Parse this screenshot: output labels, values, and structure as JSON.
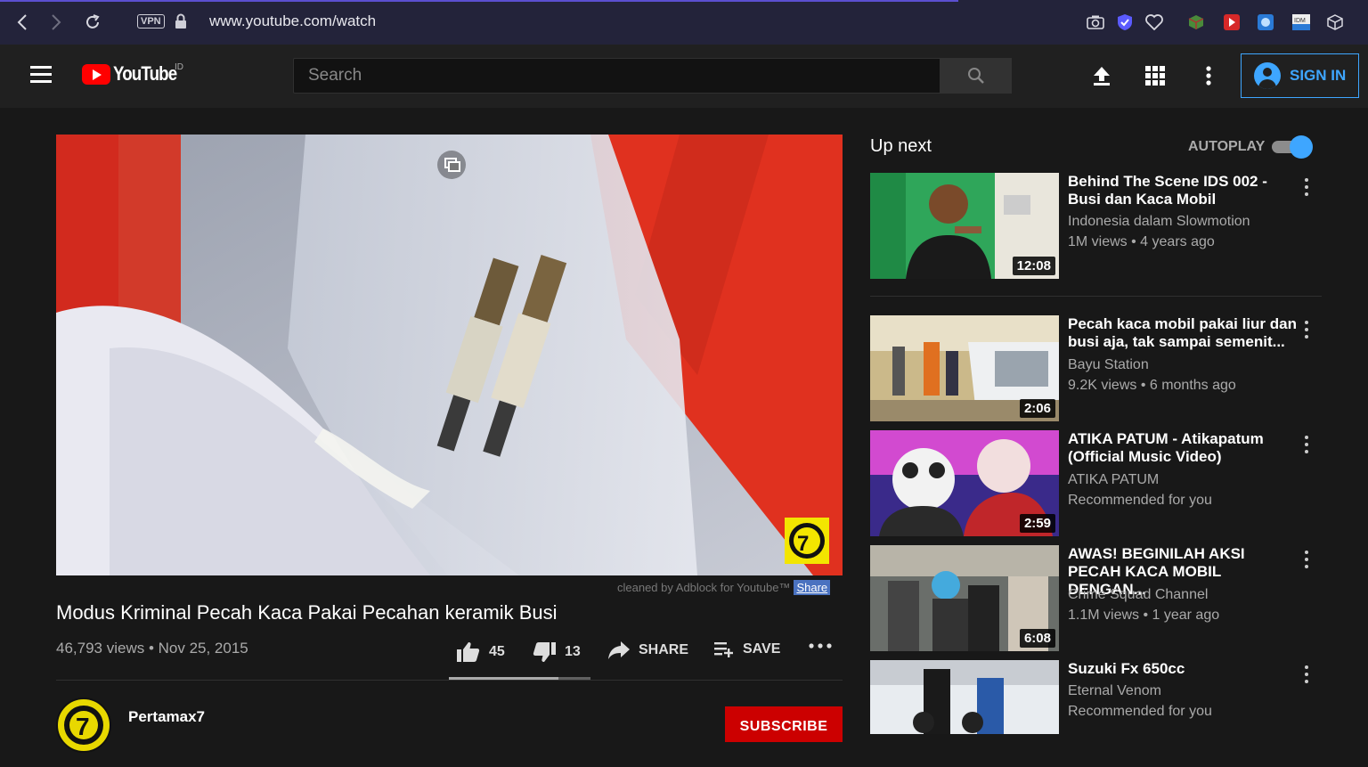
{
  "browser": {
    "url": "www.youtube.com/watch",
    "vpn_label": "VPN"
  },
  "header": {
    "logo_text": "YouTube",
    "logo_country": "ID",
    "search_placeholder": "Search",
    "sign_in_label": "SIGN IN"
  },
  "video": {
    "title": "Modus Kriminal Pecah Kaca Pakai Pecahan keramik Busi",
    "meta": "46,793 views • Nov 25, 2015",
    "likes": "45",
    "dislikes": "13",
    "like_ratio": 0.776,
    "share_label": "SHARE",
    "save_label": "SAVE",
    "adblock_text": "cleaned by Adblock for Youtube™",
    "adblock_share": "Share",
    "channel": "Pertamax7",
    "subscribe_label": "SUBSCRIBE"
  },
  "sidebar": {
    "up_next_label": "Up next",
    "autoplay_label": "AUTOPLAY",
    "autoplay_on": true,
    "items": [
      {
        "title": "Behind The Scene IDS 002 - Busi dan Kaca Mobil",
        "channel": "Indonesia dalam Slowmotion",
        "meta": "1M views • 4 years ago",
        "duration": "12:08"
      },
      {
        "title": "Pecah kaca mobil pakai liur dan busi aja, tak sampai semenit...",
        "channel": "Bayu Station",
        "meta": "9.2K views • 6 months ago",
        "duration": "2:06"
      },
      {
        "title": "ATIKA PATUM - Atikapatum (Official Music Video)",
        "channel": "ATIKA PATUM",
        "meta": "Recommended for you",
        "duration": "2:59"
      },
      {
        "title": "AWAS! BEGINILAH AKSI PECAH KACA MOBIL DENGAN...",
        "channel": "Crime Squad Channel",
        "meta": "1.1M views • 1 year ago",
        "duration": "6:08"
      },
      {
        "title": "Suzuki Fx 650cc",
        "channel": "Eternal Venom",
        "meta": "Recommended for you",
        "duration": ""
      }
    ]
  }
}
